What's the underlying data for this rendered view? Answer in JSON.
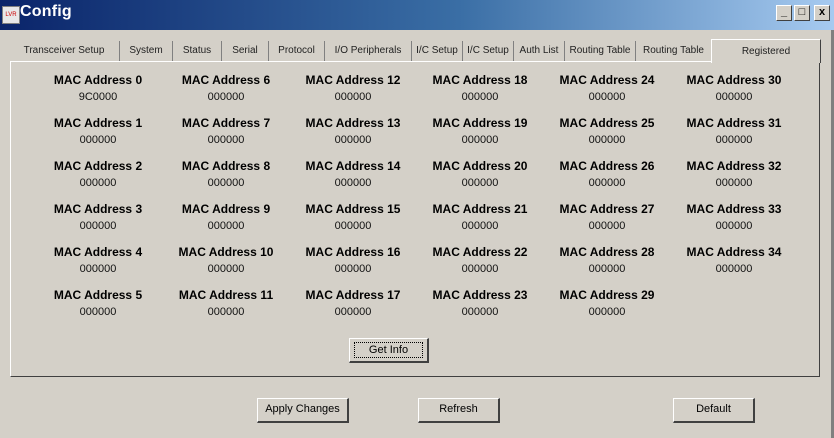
{
  "window": {
    "title": "Config",
    "icon_label": "LVR",
    "controls": {
      "minimize": "_",
      "maximize": "□",
      "close": "x"
    }
  },
  "tabs": [
    {
      "label": "Transceiver Setup"
    },
    {
      "label": "System"
    },
    {
      "label": "Status"
    },
    {
      "label": "Serial"
    },
    {
      "label": "Protocol"
    },
    {
      "label": "I/O Peripherals"
    },
    {
      "label": "I/C Setup"
    },
    {
      "label": "I/C Setup"
    },
    {
      "label": "Auth List"
    },
    {
      "label": "Routing Table"
    },
    {
      "label": "Routing Table"
    },
    {
      "label": "Registered",
      "active": true
    }
  ],
  "mac_addresses": [
    {
      "label": "MAC Address 0",
      "value": "9C0000"
    },
    {
      "label": "MAC Address 1",
      "value": "000000"
    },
    {
      "label": "MAC Address 2",
      "value": "000000"
    },
    {
      "label": "MAC Address 3",
      "value": "000000"
    },
    {
      "label": "MAC Address 4",
      "value": "000000"
    },
    {
      "label": "MAC Address 5",
      "value": "000000"
    },
    {
      "label": "MAC Address 6",
      "value": "000000"
    },
    {
      "label": "MAC Address 7",
      "value": "000000"
    },
    {
      "label": "MAC Address 8",
      "value": "000000"
    },
    {
      "label": "MAC Address 9",
      "value": "000000"
    },
    {
      "label": "MAC Address 10",
      "value": "000000"
    },
    {
      "label": "MAC Address 11",
      "value": "000000"
    },
    {
      "label": "MAC Address 12",
      "value": "000000"
    },
    {
      "label": "MAC Address 13",
      "value": "000000"
    },
    {
      "label": "MAC Address 14",
      "value": "000000"
    },
    {
      "label": "MAC Address 15",
      "value": "000000"
    },
    {
      "label": "MAC Address 16",
      "value": "000000"
    },
    {
      "label": "MAC Address 17",
      "value": "000000"
    },
    {
      "label": "MAC Address 18",
      "value": "000000"
    },
    {
      "label": "MAC Address 19",
      "value": "000000"
    },
    {
      "label": "MAC Address 20",
      "value": "000000"
    },
    {
      "label": "MAC Address 21",
      "value": "000000"
    },
    {
      "label": "MAC Address 22",
      "value": "000000"
    },
    {
      "label": "MAC Address 23",
      "value": "000000"
    },
    {
      "label": "MAC Address 24",
      "value": "000000"
    },
    {
      "label": "MAC Address 25",
      "value": "000000"
    },
    {
      "label": "MAC Address 26",
      "value": "000000"
    },
    {
      "label": "MAC Address 27",
      "value": "000000"
    },
    {
      "label": "MAC Address 28",
      "value": "000000"
    },
    {
      "label": "MAC Address 29",
      "value": "000000"
    },
    {
      "label": "MAC Address 30",
      "value": "000000"
    },
    {
      "label": "MAC Address 31",
      "value": "000000"
    },
    {
      "label": "MAC Address 32",
      "value": "000000"
    },
    {
      "label": "MAC Address 33",
      "value": "000000"
    },
    {
      "label": "MAC Address 34",
      "value": "000000"
    }
  ],
  "buttons": {
    "get_info": "Get Info",
    "apply_changes": "Apply Changes",
    "refresh": "Refresh",
    "default": "Default"
  }
}
